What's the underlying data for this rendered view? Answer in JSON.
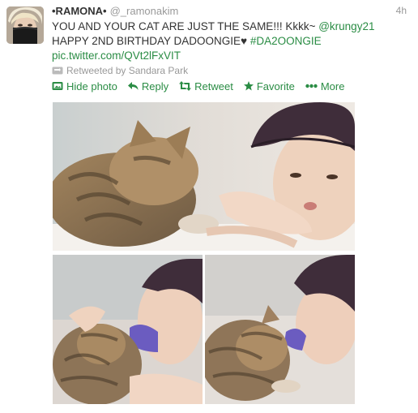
{
  "tweet": {
    "display_name": "•RAMONA•",
    "screen_name": "@_ramonakim",
    "timestamp": "4h",
    "text_part1": "YOU AND YOUR CAT ARE JUST THE SAME!!! Kkkk~ ",
    "mention": "@krungy21",
    "text_part2": "HAPPY 2ND BIRTHDAY DADOONGIE♥ ",
    "hashtag": "#DA2OONGIE",
    "pic_link": "pic.twitter.com/QVt2lFxVIT",
    "retweeted_by": "Retweeted by Sandara Park"
  },
  "actions": {
    "hide_photo": "Hide photo",
    "reply": "Reply",
    "retweet": "Retweet",
    "favorite": "Favorite",
    "more": "More"
  },
  "colors": {
    "link": "#2a8c44",
    "meta": "#999999",
    "text": "#333333"
  },
  "icons": [
    "photo-icon",
    "reply-icon",
    "retweet-icon",
    "favorite-star-icon",
    "more-dots-icon"
  ]
}
